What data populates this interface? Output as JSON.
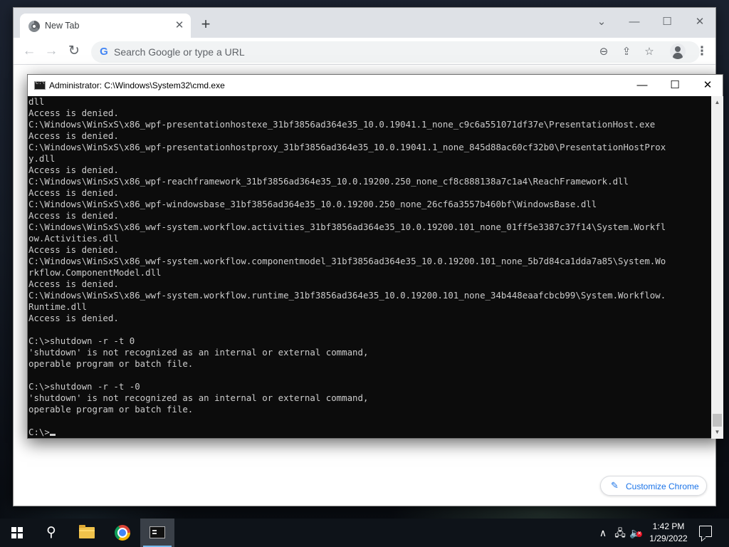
{
  "browser": {
    "tab": {
      "title": "New Tab",
      "close_glyph": "✕"
    },
    "new_tab_glyph": "+",
    "window_controls": {
      "tabsearch": "⌄",
      "minimize": "—",
      "maximize": "☐",
      "close": "✕"
    },
    "nav": {
      "back": "←",
      "forward": "→",
      "reload": "↻"
    },
    "omnibox": {
      "placeholder": "Search Google or type a URL",
      "value": "",
      "google_glyph": "G"
    },
    "omnibox_icons": {
      "zoom": "⊖",
      "share": "⇪",
      "bookmark": "☆"
    },
    "menu_glyph": "⋮",
    "customize_button": {
      "label": "Customize Chrome",
      "icon": "✎"
    }
  },
  "cmd": {
    "title": "Administrator: C:\\Windows\\System32\\cmd.exe",
    "controls": {
      "minimize": "—",
      "maximize": "☐",
      "close": "✕"
    },
    "lines": [
      "dll",
      "Access is denied.",
      "C:\\Windows\\WinSxS\\x86_wpf-presentationhostexe_31bf3856ad364e35_10.0.19041.1_none_c9c6a551071df37e\\PresentationHost.exe",
      "Access is denied.",
      "C:\\Windows\\WinSxS\\x86_wpf-presentationhostproxy_31bf3856ad364e35_10.0.19041.1_none_845d88ac60cf32b0\\PresentationHostProx",
      "y.dll",
      "Access is denied.",
      "C:\\Windows\\WinSxS\\x86_wpf-reachframework_31bf3856ad364e35_10.0.19200.250_none_cf8c888138a7c1a4\\ReachFramework.dll",
      "Access is denied.",
      "C:\\Windows\\WinSxS\\x86_wpf-windowsbase_31bf3856ad364e35_10.0.19200.250_none_26cf6a3557b460bf\\WindowsBase.dll",
      "Access is denied.",
      "C:\\Windows\\WinSxS\\x86_wwf-system.workflow.activities_31bf3856ad364e35_10.0.19200.101_none_01ff5e3387c37f14\\System.Workfl",
      "ow.Activities.dll",
      "Access is denied.",
      "C:\\Windows\\WinSxS\\x86_wwf-system.workflow.componentmodel_31bf3856ad364e35_10.0.19200.101_none_5b7d84ca1dda7a85\\System.Wo",
      "rkflow.ComponentModel.dll",
      "Access is denied.",
      "C:\\Windows\\WinSxS\\x86_wwf-system.workflow.runtime_31bf3856ad364e35_10.0.19200.101_none_34b448eaafcbcb99\\System.Workflow.",
      "Runtime.dll",
      "Access is denied.",
      "",
      "C:\\>shutdown -r -t 0",
      "'shutdown' is not recognized as an internal or external command,",
      "operable program or batch file.",
      "",
      "C:\\>shutdown -r -t -0",
      "'shutdown' is not recognized as an internal or external command,",
      "operable program or batch file.",
      ""
    ],
    "prompt": "C:\\>",
    "scrollbar": {
      "up": "▲",
      "down": "▼"
    }
  },
  "taskbar": {
    "search_glyph": "⚲",
    "tray": {
      "chevron": "∧",
      "network": "🖧",
      "volume": "🔈",
      "mute_badge": "✕"
    },
    "clock": {
      "time": "1:42 PM",
      "date": "1/29/2022"
    }
  }
}
